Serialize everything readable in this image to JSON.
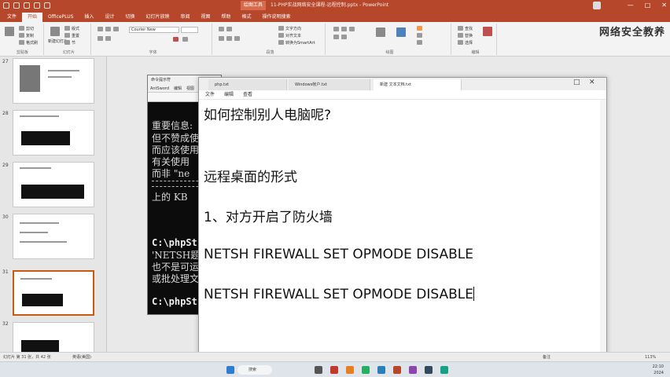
{
  "titlebar": {
    "context_tab": "绘图工具",
    "doc_title": "11-PHP实战网络安全课程-远程控制.pptx - PowerPoint",
    "window_controls": [
      "—",
      "□",
      "✕"
    ]
  },
  "ribbon_tabs": [
    "文件",
    "开始",
    "OfficePLUS",
    "插入",
    "设计",
    "切换",
    "幻灯片放映",
    "审阅",
    "视图",
    "帮助",
    "格式",
    "操作说明搜索"
  ],
  "ribbon": {
    "font_name": "Courier New",
    "group_labels": [
      "剪贴板",
      "幻灯片",
      "字体",
      "段落",
      "绘图",
      "编辑"
    ],
    "clipboard_items": [
      "剪切",
      "复制",
      "格式刷"
    ],
    "slide_items": [
      "新建幻灯片",
      "版式",
      "重置",
      "节"
    ],
    "paragraph_items": [
      "文字方向",
      "对齐文本",
      "转换为SmartArt"
    ],
    "edit_items": [
      "查找",
      "替换",
      "选择"
    ],
    "watermark": "网络安全教养"
  },
  "slides": [
    {
      "num": "27"
    },
    {
      "num": "28"
    },
    {
      "num": "29"
    },
    {
      "num": "30"
    },
    {
      "num": "31"
    },
    {
      "num": "32"
    }
  ],
  "cmd": {
    "title": "命令提示符",
    "menu": [
      "AntSword",
      "编辑",
      "视图"
    ],
    "lines": [
      "重要信息:",
      "但不赞成使",
      "而应该使用",
      "有关使用",
      "而非 \"ne",
      "上的 KB",
      "C:\\phpSt",
      "'NETSH题",
      "也不是可运",
      "或批处理文",
      "C:\\phpSt"
    ]
  },
  "notepad": {
    "tabs": [
      "php.txt",
      "Windows帐户.txt",
      "新建 文本文档.txt"
    ],
    "menu": [
      "文件",
      "编辑",
      "查看"
    ],
    "lines": [
      "如何控制别人电脑呢?",
      "远程桌面的形式",
      "1、对方开启了防火墙",
      "NETSH FIREWALL SET OPMODE DISABLE",
      "NETSH FIREWALL SET OPMODE DISABLE"
    ]
  },
  "statusbar": {
    "slide_info": "幻灯片 第 31 张，共 42 张",
    "lang": "英语(美国)",
    "notes": "备注",
    "zoom": "113%"
  },
  "taskbar": {
    "search": "搜索",
    "time": "22:10",
    "date": "2024"
  }
}
